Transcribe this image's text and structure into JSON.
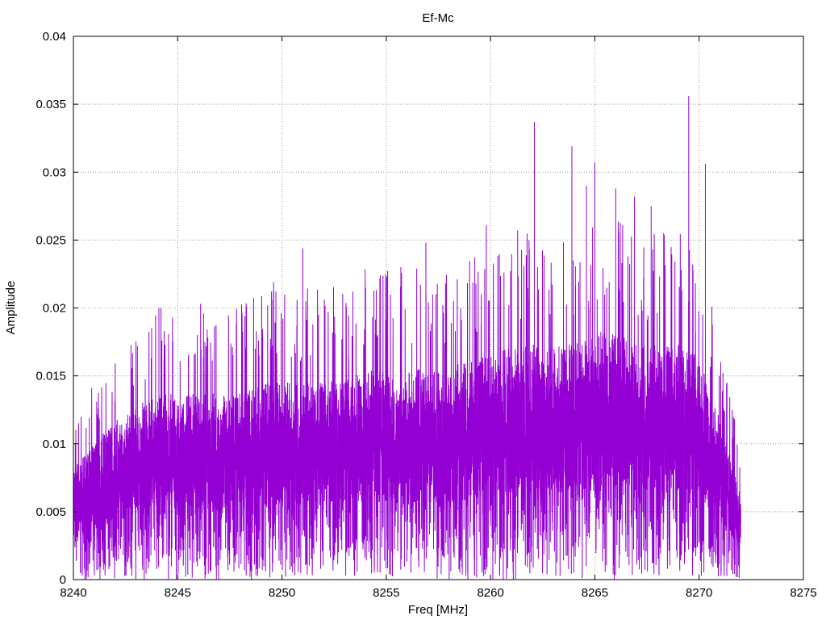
{
  "chart_data": {
    "type": "line",
    "title": "Ef-Mc",
    "xlabel": "Freq [MHz]",
    "ylabel": "Amplitude",
    "xlim": [
      8240,
      8275
    ],
    "ylim": [
      0,
      0.04
    ],
    "xticks": [
      "8240",
      "8245",
      "8250",
      "8255",
      "8260",
      "8265",
      "8270",
      "8275"
    ],
    "yticks": [
      "0",
      "0.005",
      "0.01",
      "0.015",
      "0.02",
      "0.025",
      "0.03",
      "0.035",
      "0.04"
    ],
    "grid": true,
    "series": [
      {
        "name": "Ef-Mc",
        "color": "#9400d3",
        "x_range": [
          8240,
          8272
        ],
        "envelope_note": "dense noisy spectrum; per-MHz typical low / high",
        "envelope": [
          [
            8240,
            0.001,
            0.009
          ],
          [
            8241,
            0.001,
            0.011
          ],
          [
            8242,
            0.0015,
            0.013
          ],
          [
            8243,
            0.0015,
            0.014
          ],
          [
            8244,
            0.002,
            0.015
          ],
          [
            8245,
            0.002,
            0.015
          ],
          [
            8246,
            0.002,
            0.015
          ],
          [
            8247,
            0.002,
            0.015
          ],
          [
            8248,
            0.002,
            0.015
          ],
          [
            8249,
            0.002,
            0.016
          ],
          [
            8250,
            0.002,
            0.016
          ],
          [
            8251,
            0.002,
            0.016
          ],
          [
            8252,
            0.002,
            0.016
          ],
          [
            8253,
            0.002,
            0.016
          ],
          [
            8254,
            0.002,
            0.017
          ],
          [
            8255,
            0.002,
            0.017
          ],
          [
            8256,
            0.002,
            0.017
          ],
          [
            8257,
            0.002,
            0.017
          ],
          [
            8258,
            0.002,
            0.017
          ],
          [
            8259,
            0.002,
            0.018
          ],
          [
            8260,
            0.002,
            0.018
          ],
          [
            8261,
            0.002,
            0.019
          ],
          [
            8262,
            0.002,
            0.019
          ],
          [
            8263,
            0.002,
            0.019
          ],
          [
            8264,
            0.002,
            0.019
          ],
          [
            8265,
            0.003,
            0.02
          ],
          [
            8266,
            0.003,
            0.02
          ],
          [
            8267,
            0.003,
            0.019
          ],
          [
            8268,
            0.002,
            0.019
          ],
          [
            8269,
            0.002,
            0.019
          ],
          [
            8270,
            0.002,
            0.018
          ],
          [
            8271,
            0.001,
            0.013
          ],
          [
            8272,
            0.001,
            0.007
          ]
        ],
        "peaks": [
          [
            8244.1,
            0.02
          ],
          [
            8246.1,
            0.0203
          ],
          [
            8249.6,
            0.0219
          ],
          [
            8251.0,
            0.0244
          ],
          [
            8253.4,
            0.0212
          ],
          [
            8255.7,
            0.023
          ],
          [
            8256.9,
            0.0248
          ],
          [
            8259.8,
            0.0261
          ],
          [
            8261.3,
            0.0257
          ],
          [
            8262.1,
            0.0337
          ],
          [
            8263.9,
            0.0319
          ],
          [
            8264.6,
            0.029
          ],
          [
            8265.0,
            0.0307
          ],
          [
            8266.0,
            0.0288
          ],
          [
            8266.9,
            0.0282
          ],
          [
            8267.7,
            0.0275
          ],
          [
            8268.3,
            0.0255
          ],
          [
            8269.5,
            0.0356
          ],
          [
            8270.3,
            0.0306
          ]
        ]
      }
    ]
  }
}
